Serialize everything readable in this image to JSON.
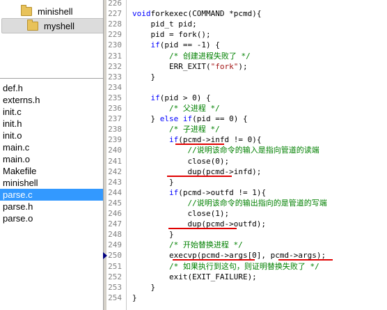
{
  "folders": [
    {
      "label": "minishell",
      "selected": false
    },
    {
      "label": "myshell",
      "selected": true
    }
  ],
  "files": [
    {
      "label": "def.h",
      "selected": false
    },
    {
      "label": "externs.h",
      "selected": false
    },
    {
      "label": "init.c",
      "selected": false
    },
    {
      "label": "init.h",
      "selected": false
    },
    {
      "label": "init.o",
      "selected": false
    },
    {
      "label": "main.c",
      "selected": false
    },
    {
      "label": "main.o",
      "selected": false
    },
    {
      "label": "Makefile",
      "selected": false
    },
    {
      "label": "minishell",
      "selected": false
    },
    {
      "label": "parse.c",
      "selected": true
    },
    {
      "label": "parse.h",
      "selected": false
    },
    {
      "label": "parse.o",
      "selected": false
    }
  ],
  "code_lines": [
    {
      "num": "226",
      "tokens": []
    },
    {
      "num": "227",
      "tokens": [
        [
          "kw",
          "void"
        ],
        [
          "",
          "forkexec(COMMAND *pcmd){"
        ]
      ]
    },
    {
      "num": "228",
      "tokens": [
        [
          "",
          "    pid_t pid;"
        ]
      ]
    },
    {
      "num": "229",
      "tokens": [
        [
          "",
          "    pid = fork();"
        ]
      ]
    },
    {
      "num": "230",
      "tokens": [
        [
          "",
          "    "
        ],
        [
          "kw",
          "if"
        ],
        [
          "",
          "(pid == -1) {"
        ]
      ]
    },
    {
      "num": "231",
      "tokens": [
        [
          "",
          "        "
        ],
        [
          "cm",
          "/* 创建进程失败了 */"
        ]
      ]
    },
    {
      "num": "232",
      "tokens": [
        [
          "",
          "        ERR_EXIT("
        ],
        [
          "str",
          "\"fork\""
        ],
        [
          "",
          ");"
        ]
      ]
    },
    {
      "num": "233",
      "tokens": [
        [
          "",
          "    }"
        ]
      ]
    },
    {
      "num": "234",
      "tokens": []
    },
    {
      "num": "235",
      "tokens": [
        [
          "",
          "    "
        ],
        [
          "kw",
          "if"
        ],
        [
          "",
          "(pid > 0) {"
        ]
      ]
    },
    {
      "num": "236",
      "tokens": [
        [
          "",
          "        "
        ],
        [
          "cm",
          "/* 父进程 */"
        ]
      ]
    },
    {
      "num": "237",
      "tokens": [
        [
          "",
          "    } "
        ],
        [
          "kw",
          "else if"
        ],
        [
          "",
          "(pid == 0) {"
        ]
      ]
    },
    {
      "num": "238",
      "tokens": [
        [
          "",
          "        "
        ],
        [
          "cm",
          "/* 子进程 */"
        ]
      ]
    },
    {
      "num": "239",
      "tokens": [
        [
          "",
          "        "
        ],
        [
          "kw",
          "if"
        ],
        [
          "",
          "(pcmd->infd != 0){"
        ]
      ]
    },
    {
      "num": "240",
      "tokens": [
        [
          "",
          "            "
        ],
        [
          "cm",
          "//说明该命令的输入是指向管道的读端"
        ]
      ]
    },
    {
      "num": "241",
      "tokens": [
        [
          "",
          "            close(0);"
        ]
      ]
    },
    {
      "num": "242",
      "tokens": [
        [
          "",
          "            dup(pcmd->infd);"
        ]
      ]
    },
    {
      "num": "243",
      "tokens": [
        [
          "",
          "        }"
        ]
      ]
    },
    {
      "num": "244",
      "tokens": [
        [
          "",
          "        "
        ],
        [
          "kw",
          "if"
        ],
        [
          "",
          "(pcmd->outfd != 1){"
        ]
      ]
    },
    {
      "num": "245",
      "tokens": [
        [
          "",
          "            "
        ],
        [
          "cm",
          "//说明该命令的输出指向的是管道的写端"
        ]
      ]
    },
    {
      "num": "246",
      "tokens": [
        [
          "",
          "            close(1);"
        ]
      ]
    },
    {
      "num": "247",
      "tokens": [
        [
          "",
          "            dup(pcmd->outfd);"
        ]
      ]
    },
    {
      "num": "248",
      "tokens": [
        [
          "",
          "        }"
        ]
      ]
    },
    {
      "num": "249",
      "tokens": [
        [
          "",
          "        "
        ],
        [
          "cm",
          "/* 开始替换进程 */"
        ]
      ]
    },
    {
      "num": "250",
      "tokens": [
        [
          "",
          "        execvp(pcmd->args[0], pcmd->args);"
        ]
      ]
    },
    {
      "num": "251",
      "tokens": [
        [
          "",
          "        "
        ],
        [
          "cm",
          "/* 如果执行到这句，则证明替换失败了 */"
        ]
      ]
    },
    {
      "num": "252",
      "tokens": [
        [
          "",
          "        exit(EXIT_FAILURE);"
        ]
      ]
    },
    {
      "num": "253",
      "tokens": [
        [
          "",
          "    }"
        ]
      ]
    },
    {
      "num": "254",
      "tokens": [
        [
          "",
          "}"
        ]
      ]
    }
  ],
  "current_line": "250",
  "colors": {
    "keyword": "#0000ff",
    "string": "#a31515",
    "comment": "#008000",
    "annotation": "#e00000",
    "selection": "#3399ff"
  }
}
